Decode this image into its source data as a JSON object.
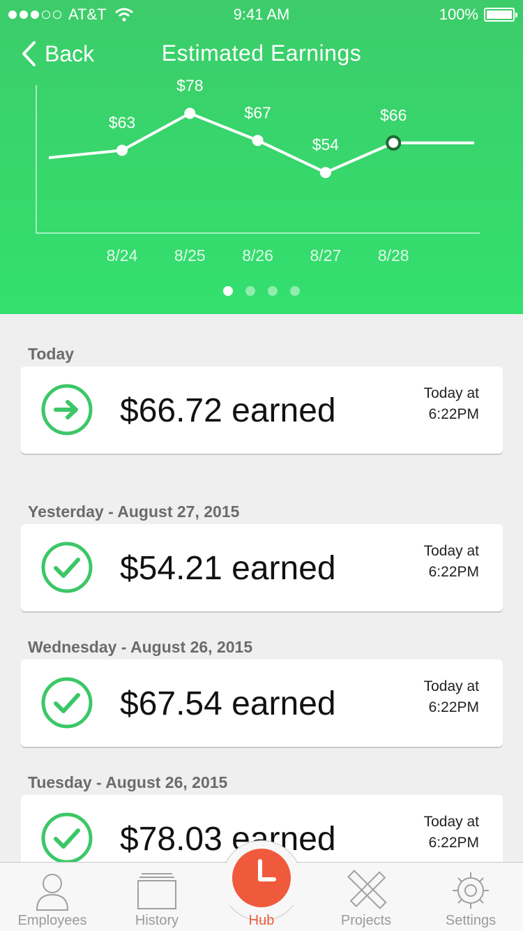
{
  "status_bar": {
    "carrier": "AT&T",
    "time": "9:41 AM",
    "battery": "100%",
    "signal_bars_filled": 3,
    "signal_bars_total": 5
  },
  "nav": {
    "back_label": "Back",
    "title": "Estimated Earnings"
  },
  "chart_data": {
    "type": "line",
    "categories": [
      "8/24",
      "8/25",
      "8/26",
      "8/27",
      "8/28"
    ],
    "values": [
      63,
      78,
      67,
      54,
      66
    ],
    "data_labels": [
      "$63",
      "$78",
      "$67",
      "$54",
      "$66"
    ],
    "lead_in_value": 60,
    "tail_value": 66,
    "ylim": [
      30,
      90
    ],
    "highlight_index": 4,
    "grid": false,
    "line_color": "#ffffff",
    "highlight_color": "#1e6b34"
  },
  "pager": {
    "count": 4,
    "active": 0
  },
  "colors": {
    "accent": "#3ccc6a",
    "icon_green": "#3cc767",
    "hub": "#f05a3c",
    "tab_inactive": "#9a9a9a"
  },
  "feed": [
    {
      "section": "Today",
      "amount": "$66.72 earned",
      "when_line1": "Today at",
      "when_line2": "6:22PM",
      "icon": "arrow-right-circle-icon"
    },
    {
      "section": "Yesterday - August 27, 2015",
      "amount": "$54.21 earned",
      "when_line1": "Today at",
      "when_line2": "6:22PM",
      "icon": "checkmark-circle-icon"
    },
    {
      "section": "Wednesday - August 26, 2015",
      "amount": "$67.54 earned",
      "when_line1": "Today at",
      "when_line2": "6:22PM",
      "icon": "checkmark-circle-icon"
    },
    {
      "section": "Tuesday - August 26, 2015",
      "amount": "$78.03 earned",
      "when_line1": "Today at",
      "when_line2": "6:22PM",
      "icon": "checkmark-circle-icon"
    }
  ],
  "tabbar": {
    "items": [
      {
        "label": "Employees",
        "icon": "person-icon"
      },
      {
        "label": "History",
        "icon": "history-stack-icon"
      },
      {
        "label": "Hub",
        "icon": "clock-icon",
        "active": true
      },
      {
        "label": "Projects",
        "icon": "ruler-pencil-icon"
      },
      {
        "label": "Settings",
        "icon": "gear-icon"
      }
    ]
  }
}
